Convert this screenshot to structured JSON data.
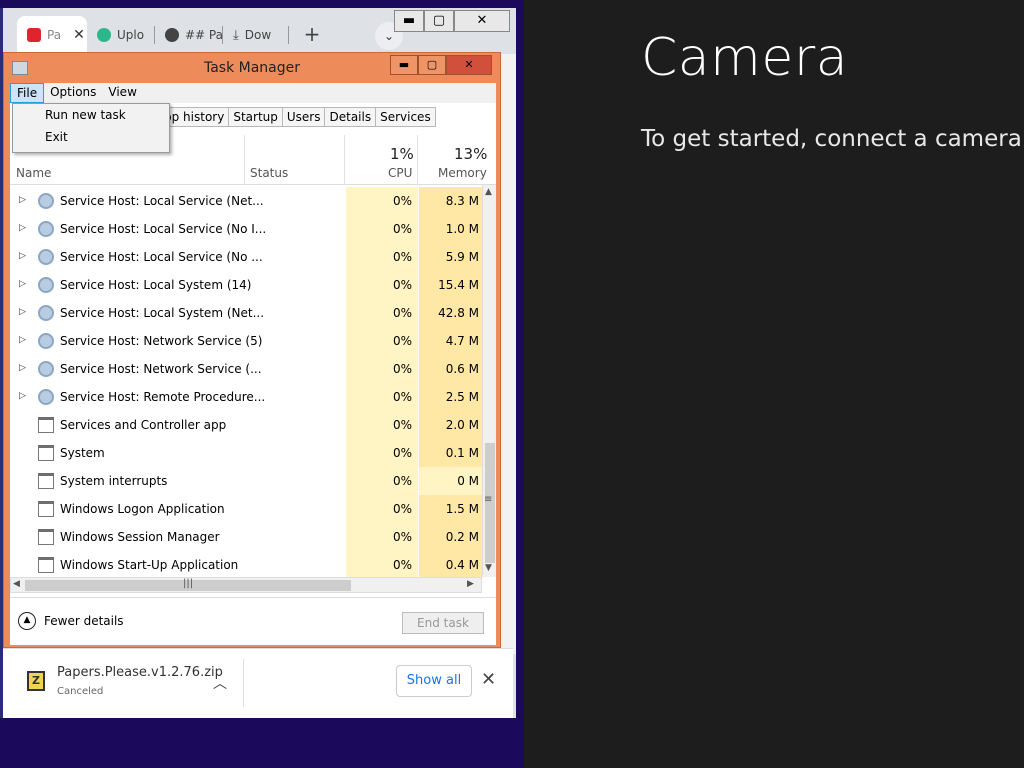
{
  "camera": {
    "title": "Camera",
    "message": "To get started, connect a camera."
  },
  "browser": {
    "tabs": [
      {
        "label": "Pa",
        "icon": "lock-icon",
        "color": "#e0242f"
      },
      {
        "label": "Uplo",
        "icon": "upload-icon",
        "color": "#2bb68b"
      },
      {
        "label": "## Pa",
        "icon": "globe-icon",
        "color": "#333333"
      },
      {
        "label": "Dow",
        "icon": "download-icon",
        "color": "#333333"
      }
    ],
    "tab_close": "✕",
    "new_tab": "+",
    "tab_dropdown": "⌄",
    "min": "▬",
    "max": "▢",
    "close": "✕"
  },
  "task_manager": {
    "title": "Task Manager",
    "menu": [
      "File",
      "Options",
      "View"
    ],
    "file_menu": [
      "Run new task",
      "Exit"
    ],
    "tabs": [
      "pp history",
      "Startup",
      "Users",
      "Details",
      "Services"
    ],
    "columns": {
      "name": "Name",
      "status": "Status",
      "cpu_pct": "1%",
      "cpu": "CPU",
      "mem_pct": "13%",
      "memory": "Memory"
    },
    "rows": [
      {
        "name": "Service Host: Local Service (Net...",
        "cpu": "0%",
        "mem": "8.3 M",
        "expandable": true,
        "icon": "gear"
      },
      {
        "name": "Service Host: Local Service (No I...",
        "cpu": "0%",
        "mem": "1.0 M",
        "expandable": true,
        "icon": "gear"
      },
      {
        "name": "Service Host: Local Service (No ...",
        "cpu": "0%",
        "mem": "5.9 M",
        "expandable": true,
        "icon": "gear"
      },
      {
        "name": "Service Host: Local System (14)",
        "cpu": "0%",
        "mem": "15.4 M",
        "expandable": true,
        "icon": "gear"
      },
      {
        "name": "Service Host: Local System (Net...",
        "cpu": "0%",
        "mem": "42.8 M",
        "expandable": true,
        "icon": "gear"
      },
      {
        "name": "Service Host: Network Service (5)",
        "cpu": "0%",
        "mem": "4.7 M",
        "expandable": true,
        "icon": "gear"
      },
      {
        "name": "Service Host: Network Service (...",
        "cpu": "0%",
        "mem": "0.6 M",
        "expandable": true,
        "icon": "gear"
      },
      {
        "name": "Service Host: Remote Procedure...",
        "cpu": "0%",
        "mem": "2.5 M",
        "expandable": true,
        "icon": "gear"
      },
      {
        "name": "Services and Controller app",
        "cpu": "0%",
        "mem": "2.0 M",
        "expandable": false,
        "icon": "win"
      },
      {
        "name": "System",
        "cpu": "0%",
        "mem": "0.1 M",
        "expandable": false,
        "icon": "win"
      },
      {
        "name": "System interrupts",
        "cpu": "0%",
        "mem": "0 M",
        "expandable": false,
        "icon": "win"
      },
      {
        "name": "Windows Logon Application",
        "cpu": "0%",
        "mem": "1.5 M",
        "expandable": false,
        "icon": "win"
      },
      {
        "name": "Windows Session Manager",
        "cpu": "0%",
        "mem": "0.2 M",
        "expandable": false,
        "icon": "win"
      },
      {
        "name": "Windows Start-Up Application",
        "cpu": "0%",
        "mem": "0.4 M",
        "expandable": false,
        "icon": "win"
      }
    ],
    "fewer_details": "Fewer details",
    "end_task": "End task"
  },
  "download": {
    "filename": "Papers.Please.v1.2.76.zip",
    "status": "Canceled",
    "show_all": "Show all"
  }
}
